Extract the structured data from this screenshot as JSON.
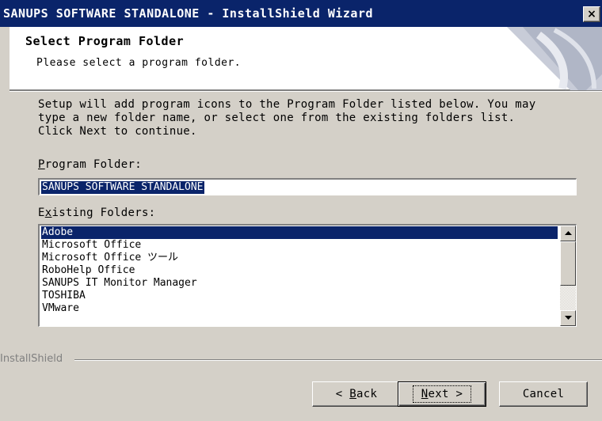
{
  "window": {
    "title": "SANUPS SOFTWARE STANDALONE - InstallShield Wizard",
    "close_glyph": "×"
  },
  "header": {
    "title": "Select Program Folder",
    "subtitle": "Please select a program folder."
  },
  "body": {
    "description": "Setup will add program icons to the Program Folder listed below.  You may\ntype a new folder name, or select one from the existing folders list.\nClick Next to continue.",
    "program_folder_label_mnemonic": "P",
    "program_folder_label_rest": "rogram Folder:",
    "program_folder_value": "SANUPS SOFTWARE STANDALONE",
    "existing_folders_label_pre": "E",
    "existing_folders_label_mnemonic": "x",
    "existing_folders_label_rest": "isting Folders:",
    "existing_folders": [
      "Adobe",
      "Microsoft Office",
      "Microsoft Office ツール",
      "RoboHelp Office",
      "SANUPS IT Monitor Manager",
      "TOSHIBA",
      "VMware"
    ],
    "selected_folder_index": 0
  },
  "footer": {
    "brand": "InstallShield",
    "back_mnemonic": "B",
    "back_pre": "< ",
    "back_rest": "ack",
    "next_mnemonic": "N",
    "next_rest": "ext >",
    "cancel_label": "Cancel"
  },
  "icons": {
    "scroll_up": "up-arrow-icon",
    "scroll_down": "down-arrow-icon"
  },
  "colors": {
    "title_bar": "#0a246a",
    "selection": "#0a246a",
    "dialog_face": "#d4d0c8"
  }
}
